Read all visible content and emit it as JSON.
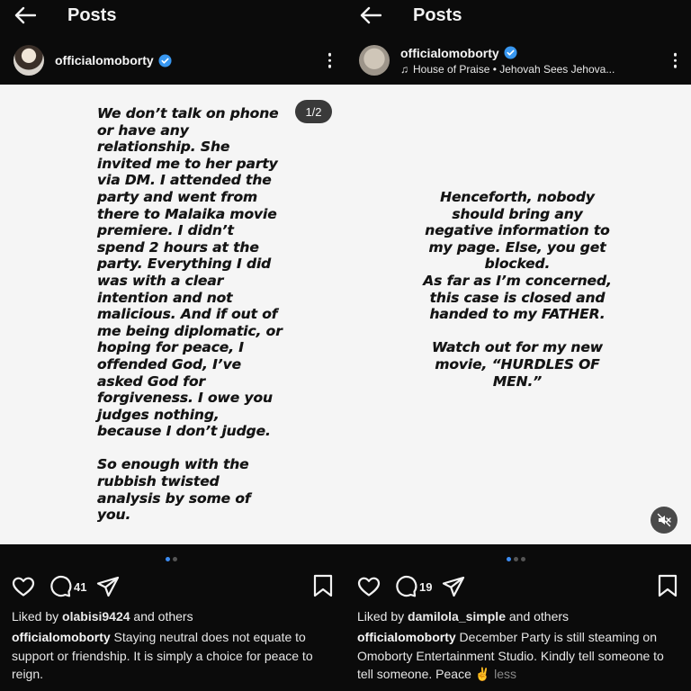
{
  "left_post": {
    "header": {
      "title": "Posts"
    },
    "profile": {
      "username": "officialomoborty"
    },
    "story_text": "We don’t talk on phone\nor have any\nrelationship. She\ninvited me to her party\nvia DM. I attended the\nparty and went from\nthere to Malaika movie\npremiere. I didn’t\nspend 2 hours at the\nparty. Everything I did\nwas with a clear\nintention and not\nmalicious. And if out of\nme being diplomatic, or\nhoping for peace, I\noffended God, I’ve\nasked God for\nforgiveness. I owe you\njudges nothing,\nbecause I don’t judge.\n\nSo enough with the\nrubbish twisted\nanalysis by some of\nyou.",
    "page_counter": "1/2",
    "comment_count": "41",
    "liked_by_user": "olabisi9424",
    "liked_by_suffix": " and others",
    "caption_username": "officialomoborty",
    "caption_text": " Staying neutral does not equate to support or friendship. It is simply a choice for peace to reign."
  },
  "right_post": {
    "header": {
      "title": "Posts"
    },
    "profile": {
      "username": "officialomoborty",
      "music": "House of Praise • Jehovah Sees Jehova..."
    },
    "story_text": "Henceforth, nobody\nshould bring any\nnegative information to\nmy page. Else, you get\nblocked.\nAs far as I’m concerned,\nthis case is closed and\nhanded to my FATHER.\n\nWatch out for my new\nmovie, “HURDLES OF\nMEN.”",
    "comment_count": "19",
    "liked_by_user": "damilola_simple",
    "liked_by_suffix": " and others",
    "caption_username": "officialomoborty",
    "caption_text": " December Party is still steaming on Omoborty Entertainment Studio. Kindly tell someone to tell someone. Peace ✌️ ",
    "less_label": "less"
  },
  "colors": {
    "background": "#0b0b0b",
    "image_background": "#f5f5f5",
    "verified": "#3897f0",
    "active_dot": "#3c8cf2"
  },
  "icons": [
    "back-arrow-icon",
    "verified-badge-icon",
    "more-options-icon",
    "music-note-icon",
    "heart-icon",
    "comment-icon",
    "share-icon",
    "bookmark-icon",
    "mute-icon"
  ]
}
